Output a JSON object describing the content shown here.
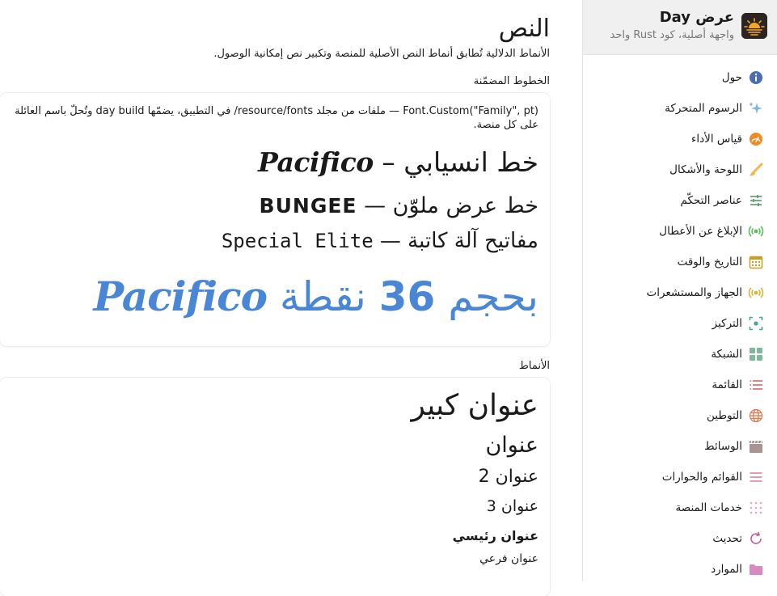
{
  "sidebar": {
    "app_title": "عرض Day",
    "app_subtitle": "واجهة أصلية، كود Rust واحد",
    "items": [
      {
        "label": "حول",
        "icon": "info-icon"
      },
      {
        "label": "الرسوم المتحركة",
        "icon": "sparkles-icon"
      },
      {
        "label": "قياس الأداء",
        "icon": "speedometer-icon"
      },
      {
        "label": "اللوحة والأشكال",
        "icon": "brush-icon"
      },
      {
        "label": "عناصر التحكّم",
        "icon": "sliders-icon"
      },
      {
        "label": "الإبلاغ عن الأعطال",
        "icon": "broadcast-icon"
      },
      {
        "label": "التاريخ والوقت",
        "icon": "calendar-icon"
      },
      {
        "label": "الجهاز والمستشعرات",
        "icon": "sensor-icon"
      },
      {
        "label": "التركيز",
        "icon": "focus-icon"
      },
      {
        "label": "الشبكة",
        "icon": "grid-icon"
      },
      {
        "label": "القائمة",
        "icon": "list-icon"
      },
      {
        "label": "التوطين",
        "icon": "globe-icon"
      },
      {
        "label": "الوسائط",
        "icon": "clapperboard-icon"
      },
      {
        "label": "القوائم والحوارات",
        "icon": "menu-icon"
      },
      {
        "label": "خدمات المنصة",
        "icon": "dots-grid-icon"
      },
      {
        "label": "تحديث",
        "icon": "refresh-icon"
      },
      {
        "label": "الموارد",
        "icon": "folder-icon"
      }
    ]
  },
  "main": {
    "title": "النص",
    "description": "الأنماط الدلالية تُطابق أنماط النص الأصلية للمنصة وتكبير نص إمكانية الوصول.",
    "fonts_section": {
      "label": "الخطوط المضمّنة",
      "note": "Font.Custom(\"Family\", pt) — ملفات من مجلد resource/fonts/ في التطبيق، يضمّها day build وتُحلّ باسم العائلة على كل منصة.",
      "demos": [
        {
          "text_ar": "خط انسيابي – ",
          "text_latin": "Pacifico"
        },
        {
          "text_ar": "خط عرض ملوّن — ",
          "text_latin": "Bungee"
        },
        {
          "text_ar": "مفاتيح آلة كاتبة — ",
          "text_latin": "Special Elite"
        },
        {
          "text_ar_1": "بحجم ",
          "number": "36",
          "text_ar_2": " نقطة ",
          "text_latin": "Pacifico"
        }
      ]
    },
    "styles_section": {
      "label": "الأنماط",
      "large_title": "عنوان كبير",
      "title": "عنوان",
      "title2": "عنوان 2",
      "title3": "عنوان 3",
      "headline": "عنوان رئيسي",
      "subheadline": "عنوان فرعي"
    }
  },
  "colors": {
    "accent_blue": "#4a86d6",
    "sidebar_header_bg": "#f0f0f0"
  }
}
